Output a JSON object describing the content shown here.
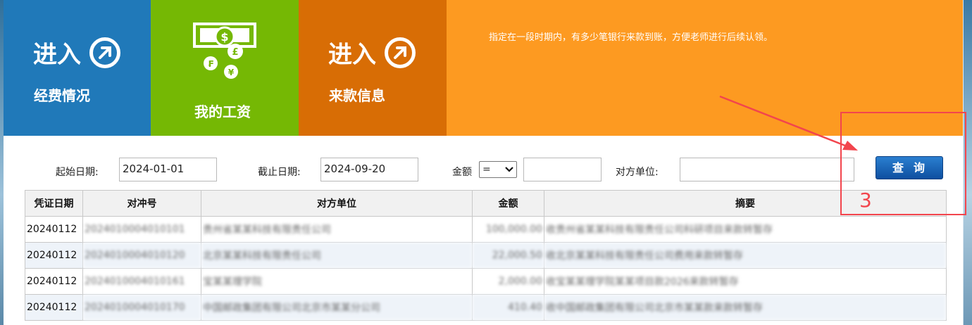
{
  "tiles": {
    "funding": {
      "enter": "进入",
      "label": "经费情况"
    },
    "salary": {
      "label": "我的工资"
    },
    "payments": {
      "enter": "进入",
      "label": "来款信息"
    },
    "tip": "指定在一段时期内，有多少笔银行来款到账，方便老师进行后续认领。"
  },
  "filter": {
    "start_label": "起始日期:",
    "start_value": "2024-01-01",
    "end_label": "截止日期:",
    "end_value": "2024-09-20",
    "amount_label": "金额",
    "amount_operator": "=",
    "amount_value": "",
    "counterparty_label": "对方单位:",
    "counterparty_value": "",
    "query_button": "查询"
  },
  "table": {
    "headers": [
      "凭证日期",
      "对冲号",
      "对方单位",
      "金额",
      "摘要"
    ],
    "rows": [
      {
        "date": "20240112",
        "id": "2024010004010101",
        "party": "贵州省某某科技有限责任公司",
        "amount": "100,000.00",
        "summary": "收贵州省某某科技有限责任公司科研项目来款转暂存"
      },
      {
        "date": "20240112",
        "id": "2024010004010120",
        "party": "北京某某科技有限责任公司",
        "amount": "22,000.50",
        "summary": "收北京某某科技有限责任公司费用来款转暂存"
      },
      {
        "date": "20240112",
        "id": "2024010004010161",
        "party": "宝某某理学院",
        "amount": "2,000.00",
        "summary": "收宝某某理学院某某项目款2026来款转暂存"
      },
      {
        "date": "20240112",
        "id": "2024010004010170",
        "party": "中国邮政集团有限公司北京市某某分公司",
        "amount": "410.40",
        "summary": "收中国邮政集团有限公司北京市某某款来款转暂存"
      }
    ]
  },
  "annotation": {
    "number": "3"
  },
  "colors": {
    "blue": "#2079b9",
    "green": "#75b804",
    "dark_orange": "#d86d05",
    "orange": "#fd9a21",
    "annotation": "#f2454d",
    "query_button": "#1565b8"
  }
}
